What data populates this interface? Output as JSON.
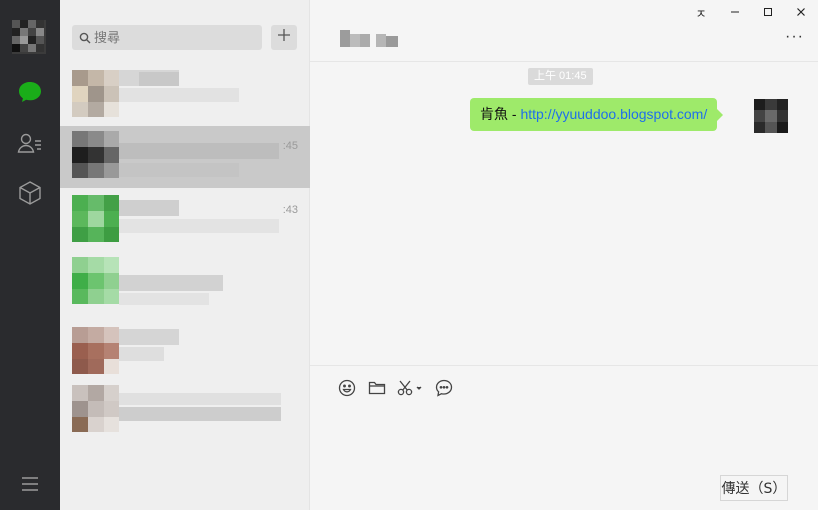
{
  "window": {
    "controls": {
      "pin_symbol": "ㅈ",
      "minimize_symbol": "—",
      "maximize_symbol": "☐",
      "close_symbol": "✕"
    }
  },
  "rail": {
    "items": [
      {
        "name": "chats",
        "icon": "chat-bubble-icon",
        "active": true,
        "color": "#1aad19"
      },
      {
        "name": "contacts",
        "icon": "contacts-icon",
        "active": false
      },
      {
        "name": "favorites",
        "icon": "cube-icon",
        "active": false
      }
    ],
    "menu_icon": "hamburger-menu-icon"
  },
  "sidebar": {
    "search": {
      "placeholder": "搜尋"
    },
    "add_label": "+",
    "conversations": [
      {
        "time": "",
        "active": false
      },
      {
        "time": ":45",
        "active": true
      },
      {
        "time": ":43",
        "active": false
      },
      {
        "time": "",
        "active": false
      },
      {
        "time": "",
        "active": false
      },
      {
        "time": "",
        "active": false
      }
    ]
  },
  "chat": {
    "more_label": "···",
    "messages": [
      {
        "timestamp": "上午 01:45",
        "sender_label": "肯魚",
        "separator": " - ",
        "link": "http://yyuuddoo.blogspot.com/"
      }
    ],
    "toolbar": [
      "emoji-icon",
      "folder-icon",
      "scissors-icon",
      "chat-history-icon"
    ],
    "send_label": "傳送（S）"
  },
  "colors": {
    "rail_bg": "#2a2b2e",
    "list_bg": "#efefef",
    "chat_bg": "#f5f5f5",
    "bubble_bg": "#9eea6a",
    "link": "#1f6feb",
    "accent_green": "#1aad19"
  }
}
